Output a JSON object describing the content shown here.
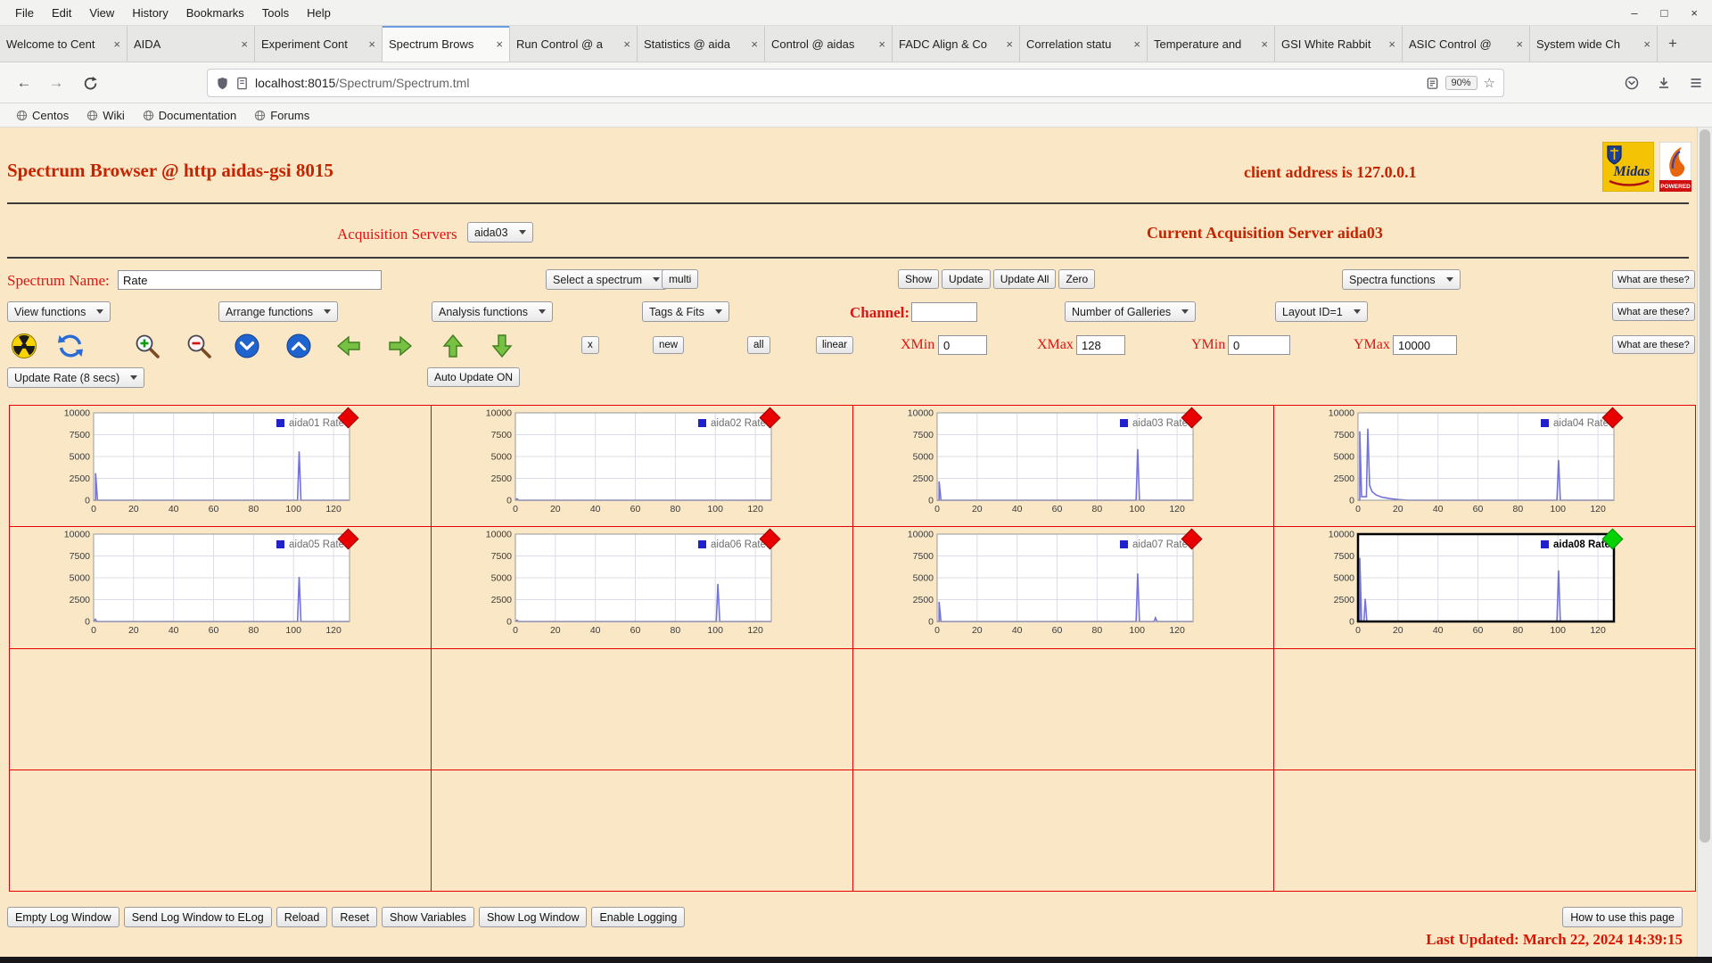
{
  "browser": {
    "menu_items": [
      "File",
      "Edit",
      "View",
      "History",
      "Bookmarks",
      "Tools",
      "Help"
    ],
    "window_controls": [
      "–",
      "□",
      "×"
    ],
    "tabs": [
      {
        "label": "Welcome to Cent",
        "active": false
      },
      {
        "label": "AIDA",
        "active": false
      },
      {
        "label": "Experiment Cont",
        "active": false
      },
      {
        "label": "Spectrum Brows",
        "active": true
      },
      {
        "label": "Run Control @ a",
        "active": false
      },
      {
        "label": "Statistics @ aida",
        "active": false
      },
      {
        "label": "Control @ aidas",
        "active": false
      },
      {
        "label": "FADC Align & Co",
        "active": false
      },
      {
        "label": "Correlation statu",
        "active": false
      },
      {
        "label": "Temperature and",
        "active": false
      },
      {
        "label": "GSI White Rabbit",
        "active": false
      },
      {
        "label": "ASIC Control @",
        "active": false
      },
      {
        "label": "System wide Ch",
        "active": false
      }
    ],
    "tab_close_glyph": "×",
    "new_tab_button": "+",
    "back_glyph": "←",
    "forward_glyph": "→",
    "url_host": "localhost:8015",
    "url_path": "/Spectrum/Spectrum.tml",
    "zoom_badge": "90%",
    "star_glyph": "☆",
    "bookmarks": [
      "Centos",
      "Wiki",
      "Documentation",
      "Forums"
    ]
  },
  "header": {
    "title": "Spectrum Browser @ http aidas-gsi 8015",
    "client_address": "client address is 127.0.0.1"
  },
  "logos": {
    "midas_text": "Midas",
    "powered_text": "POWERED"
  },
  "acquisition": {
    "label": "Acquisition Servers",
    "selected": "aida03",
    "current": "Current Acquisition Server aida03"
  },
  "controls": {
    "spectrum_name_label": "Spectrum Name:",
    "spectrum_name_value": "Rate",
    "select_spectrum": "Select a spectrum",
    "multi": "multi",
    "show": "Show",
    "update": "Update",
    "update_all": "Update All",
    "zero": "Zero",
    "spectra_functions": "Spectra functions",
    "what_are_these": "What are these?",
    "view_functions": "View functions",
    "arrange_functions": "Arrange functions",
    "analysis_functions": "Analysis functions",
    "tags_fits": "Tags & Fits",
    "channel_label": "Channel:",
    "channel_value": "",
    "number_of_galleries": "Number of Galleries",
    "layout_id": "Layout ID=1",
    "x_button": "x",
    "new_button": "new",
    "all_button": "all",
    "linear_button": "linear",
    "xmin_label": "XMin",
    "xmin_value": "0",
    "xmax_label": "XMax",
    "xmax_value": "128",
    "ymin_label": "YMin",
    "ymin_value": "0",
    "ymax_label": "YMax",
    "ymax_value": "10000",
    "update_rate": "Update Rate (8 secs)",
    "auto_update": "Auto Update ON"
  },
  "toolbar_icons": [
    "radiation-icon",
    "refresh-icon",
    "zoom-in-icon",
    "zoom-out-icon",
    "compress-vertical-icon",
    "expand-vertical-icon",
    "arrow-left-icon",
    "arrow-right-icon",
    "arrow-up-icon",
    "arrow-down-icon"
  ],
  "footer": {
    "buttons": [
      "Empty Log Window",
      "Send Log Window to ELog",
      "Reload",
      "Reset",
      "Show Variables",
      "Show Log Window",
      "Enable Logging"
    ],
    "help_button": "How to use this page",
    "last_updated": "Last Updated: March 22, 2024 14:39:15"
  },
  "colors": {
    "page_bg": "#fae7c6",
    "title_red": "#c62300",
    "label_red": "#e21313",
    "grid_border_red": "#e60000",
    "spike_blue": "#7373d9",
    "legend_blue": "#2020cc",
    "marker_red": "#e80000",
    "marker_green": "#05d205"
  },
  "chart_config": {
    "type": "line",
    "xlim": [
      0,
      128
    ],
    "ylim": [
      0,
      10000
    ],
    "xticks": [
      0,
      20,
      40,
      60,
      80,
      100,
      120
    ],
    "yticks": [
      0,
      2500,
      5000,
      7500,
      10000
    ],
    "xlabel": "",
    "ylabel": "",
    "grid": true,
    "legend_position": "top-right"
  },
  "chart_data": [
    {
      "title": "aida01 Rate",
      "marker": "red",
      "selected": false,
      "points": [
        [
          0,
          0
        ],
        [
          1,
          0
        ],
        [
          1,
          3100
        ],
        [
          1.9,
          0
        ],
        [
          102,
          0
        ],
        [
          102.8,
          5600
        ],
        [
          103.7,
          0
        ],
        [
          128,
          0
        ]
      ]
    },
    {
      "title": "aida02 Rate",
      "marker": "red",
      "selected": false,
      "points": [
        [
          0,
          0
        ],
        [
          0.8,
          160
        ],
        [
          1.6,
          0
        ],
        [
          128,
          0
        ]
      ]
    },
    {
      "title": "aida03 Rate",
      "marker": "red",
      "selected": false,
      "points": [
        [
          0,
          0
        ],
        [
          1,
          0
        ],
        [
          1,
          2150
        ],
        [
          1.9,
          0
        ],
        [
          99.5,
          0
        ],
        [
          100.3,
          5850
        ],
        [
          101.2,
          0
        ],
        [
          128,
          0
        ]
      ]
    },
    {
      "title": "aida04 Rate",
      "marker": "red",
      "selected": false,
      "points": [
        [
          0,
          0
        ],
        [
          0.9,
          0
        ],
        [
          0.9,
          7900
        ],
        [
          1.8,
          400
        ],
        [
          4.2,
          400
        ],
        [
          4.9,
          8200
        ],
        [
          5.8,
          1700
        ],
        [
          7,
          1000
        ],
        [
          9,
          600
        ],
        [
          12,
          350
        ],
        [
          16,
          180
        ],
        [
          20,
          80
        ],
        [
          25,
          0
        ],
        [
          99.5,
          0
        ],
        [
          100.3,
          4600
        ],
        [
          101.2,
          0
        ],
        [
          128,
          0
        ]
      ]
    },
    {
      "title": "aida05 Rate",
      "marker": "red",
      "selected": false,
      "points": [
        [
          0,
          0
        ],
        [
          0.8,
          260
        ],
        [
          1.6,
          0
        ],
        [
          102,
          0
        ],
        [
          102.8,
          5100
        ],
        [
          103.7,
          0
        ],
        [
          128,
          0
        ]
      ]
    },
    {
      "title": "aida06 Rate",
      "marker": "red",
      "selected": false,
      "points": [
        [
          0,
          0
        ],
        [
          0.8,
          140
        ],
        [
          1.6,
          0
        ],
        [
          100.5,
          0
        ],
        [
          101.3,
          4300
        ],
        [
          102.2,
          0
        ],
        [
          128,
          0
        ]
      ]
    },
    {
      "title": "aida07 Rate",
      "marker": "red",
      "selected": false,
      "points": [
        [
          0,
          0
        ],
        [
          1,
          0
        ],
        [
          1,
          2250
        ],
        [
          1.9,
          0
        ],
        [
          99.5,
          0
        ],
        [
          100.3,
          5500
        ],
        [
          101.2,
          0
        ],
        [
          108.5,
          0
        ],
        [
          109.2,
          420
        ],
        [
          110,
          0
        ],
        [
          128,
          0
        ]
      ]
    },
    {
      "title": "aida08 Rate",
      "marker": "green",
      "selected": true,
      "points": [
        [
          0,
          0
        ],
        [
          0.9,
          0
        ],
        [
          0.9,
          7300
        ],
        [
          1.8,
          0
        ],
        [
          3,
          0
        ],
        [
          3.6,
          2600
        ],
        [
          4.4,
          0
        ],
        [
          99.5,
          0
        ],
        [
          100.3,
          5850
        ],
        [
          101.2,
          0
        ],
        [
          128,
          0
        ]
      ]
    }
  ]
}
